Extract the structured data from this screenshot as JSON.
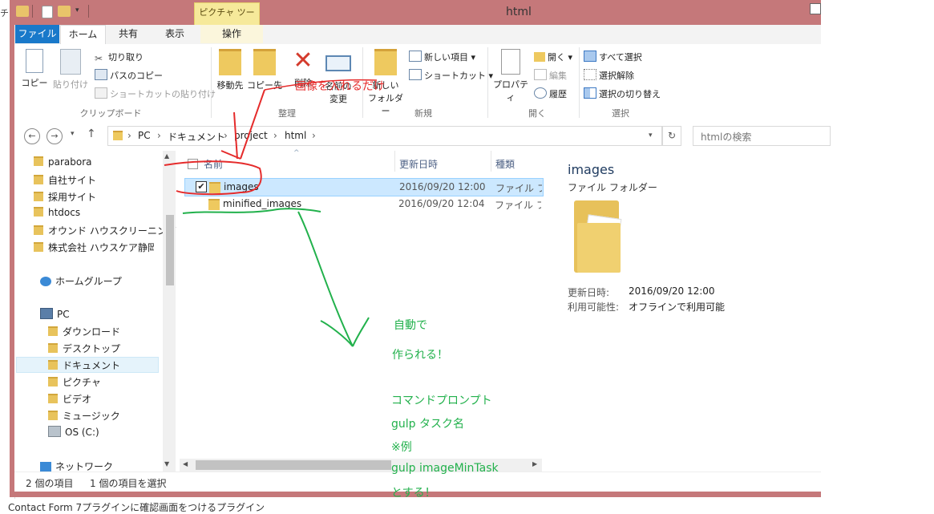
{
  "window": {
    "title": "html",
    "context_tab": "ピクチャ ツール"
  },
  "tabs": [
    "ファイル",
    "ホーム",
    "共有",
    "表示",
    "操作"
  ],
  "ribbon": {
    "clipboard": {
      "copy": "コピー",
      "paste": "貼り付け",
      "cut": "切り取り",
      "copy_path": "パスのコピー",
      "paste_shortcut": "ショートカットの貼り付け",
      "label": "クリップボード"
    },
    "organize": {
      "move_to": "移動先",
      "copy_to": "コピー先",
      "delete": "削除",
      "rename_line1": "名前の",
      "rename_line2": "変更",
      "label": "整理"
    },
    "new": {
      "new_folder_line1": "新しい",
      "new_folder_line2": "フォルダー",
      "new_item": "新しい項目",
      "shortcut": "ショートカット",
      "label": "新規"
    },
    "open": {
      "properties": "プロパティ",
      "open": "開く",
      "edit": "編集",
      "history": "履歴",
      "label": "開く"
    },
    "select": {
      "select_all": "すべて選択",
      "select_none": "選択解除",
      "invert": "選択の切り替え",
      "label": "選択"
    }
  },
  "address": {
    "crumbs": [
      "PC",
      "ドキュメント",
      "project",
      "html"
    ],
    "search_placeholder": "htmlの検索"
  },
  "nav": {
    "items": [
      "parabora",
      "自社サイト",
      "採用サイト",
      "htdocs",
      "オウンド ハウスクリーニング",
      "株式会社 ハウスケア静岡"
    ],
    "homegroup": "ホームグループ",
    "pc": "PC",
    "pc_items": [
      "ダウンロード",
      "デスクトップ",
      "ドキュメント",
      "ピクチャ",
      "ビデオ",
      "ミュージック",
      "OS (C:)"
    ],
    "network": "ネットワーク"
  },
  "files": {
    "columns": [
      "名前",
      "更新日時",
      "種類"
    ],
    "rows": [
      {
        "name": "images",
        "date": "2016/09/20 12:00",
        "type": "ファイル フォル"
      },
      {
        "name": "minified_images",
        "date": "2016/09/20 12:04",
        "type": "ファイル フォル"
      }
    ]
  },
  "preview": {
    "name": "images",
    "type": "ファイル フォルダー",
    "modified_label": "更新日時:",
    "modified_value": "2016/09/20 12:00",
    "availability_label": "利用可能性:",
    "availability_value": "オフラインで利用可能"
  },
  "status": {
    "count": "2 個の項目",
    "selected": "1 個の項目を選択"
  },
  "annotations": {
    "red": "画像を入れるだけ",
    "green": [
      "自動で",
      "作られる！",
      "コマンドプロンプト",
      "gulp タスク名",
      "※例",
      "gulp imageMinTask",
      "とする！"
    ]
  },
  "behind": {
    "bottom_text": "Contact Form 7プラグインに確認画面をつけるプラグイン",
    "top_text": "チェ"
  },
  "colors": {
    "window_frame": "#c5787a",
    "file_tab": "#1979ca",
    "selection": "#cce8ff",
    "annotation_green": "#22b14c",
    "annotation_red": "#e52b2b"
  }
}
